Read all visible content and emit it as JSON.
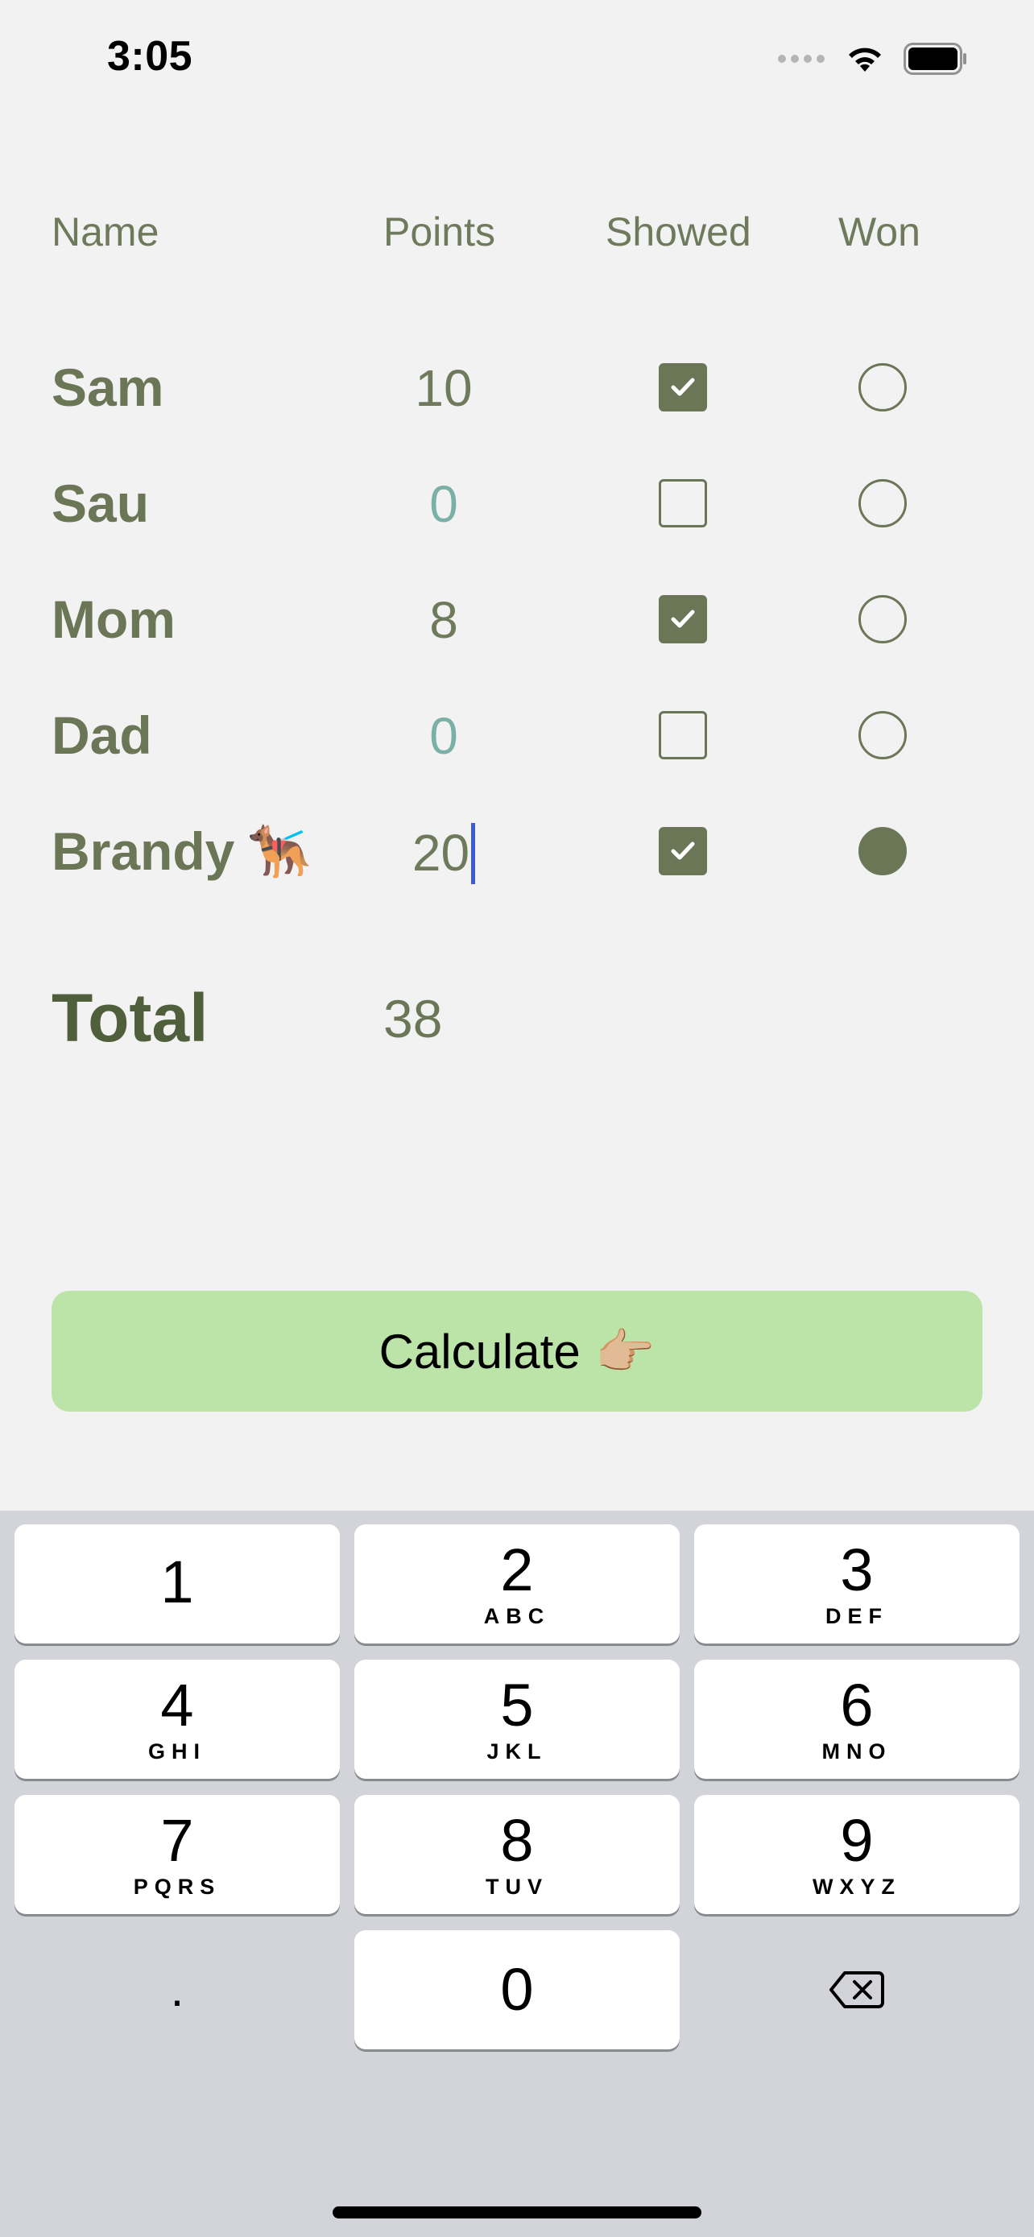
{
  "status_bar": {
    "time": "3:05"
  },
  "table": {
    "headers": {
      "name": "Name",
      "points": "Points",
      "showed": "Showed",
      "won": "Won"
    },
    "rows": [
      {
        "name": "Sam",
        "emoji": "",
        "points": "10",
        "showed": true,
        "won": false
      },
      {
        "name": "Sau",
        "emoji": "",
        "points": "0",
        "showed": false,
        "won": false
      },
      {
        "name": "Mom",
        "emoji": "",
        "points": "8",
        "showed": true,
        "won": false
      },
      {
        "name": "Dad",
        "emoji": "",
        "points": "0",
        "showed": false,
        "won": false
      },
      {
        "name": "Brandy",
        "emoji": "🐕‍🦺",
        "points": "20",
        "showed": true,
        "won": true
      }
    ]
  },
  "total": {
    "label": "Total",
    "value": "38"
  },
  "calculate_button": {
    "label": "Calculate",
    "emoji": "👉🏼"
  },
  "keypad": {
    "keys": [
      {
        "digit": "1",
        "letters": ""
      },
      {
        "digit": "2",
        "letters": "ABC"
      },
      {
        "digit": "3",
        "letters": "DEF"
      },
      {
        "digit": "4",
        "letters": "GHI"
      },
      {
        "digit": "5",
        "letters": "JKL"
      },
      {
        "digit": "6",
        "letters": "MNO"
      },
      {
        "digit": "7",
        "letters": "PQRS"
      },
      {
        "digit": "8",
        "letters": "TUV"
      },
      {
        "digit": "9",
        "letters": "WXYZ"
      },
      {
        "digit": "0",
        "letters": ""
      }
    ],
    "decimal_key": ".",
    "delete_icon": "delete-backward-icon"
  },
  "colors": {
    "accent": "#6b7656",
    "zero_points": "#7ab0a6",
    "button": "#bde4a8",
    "caret": "#3c5bdb"
  }
}
